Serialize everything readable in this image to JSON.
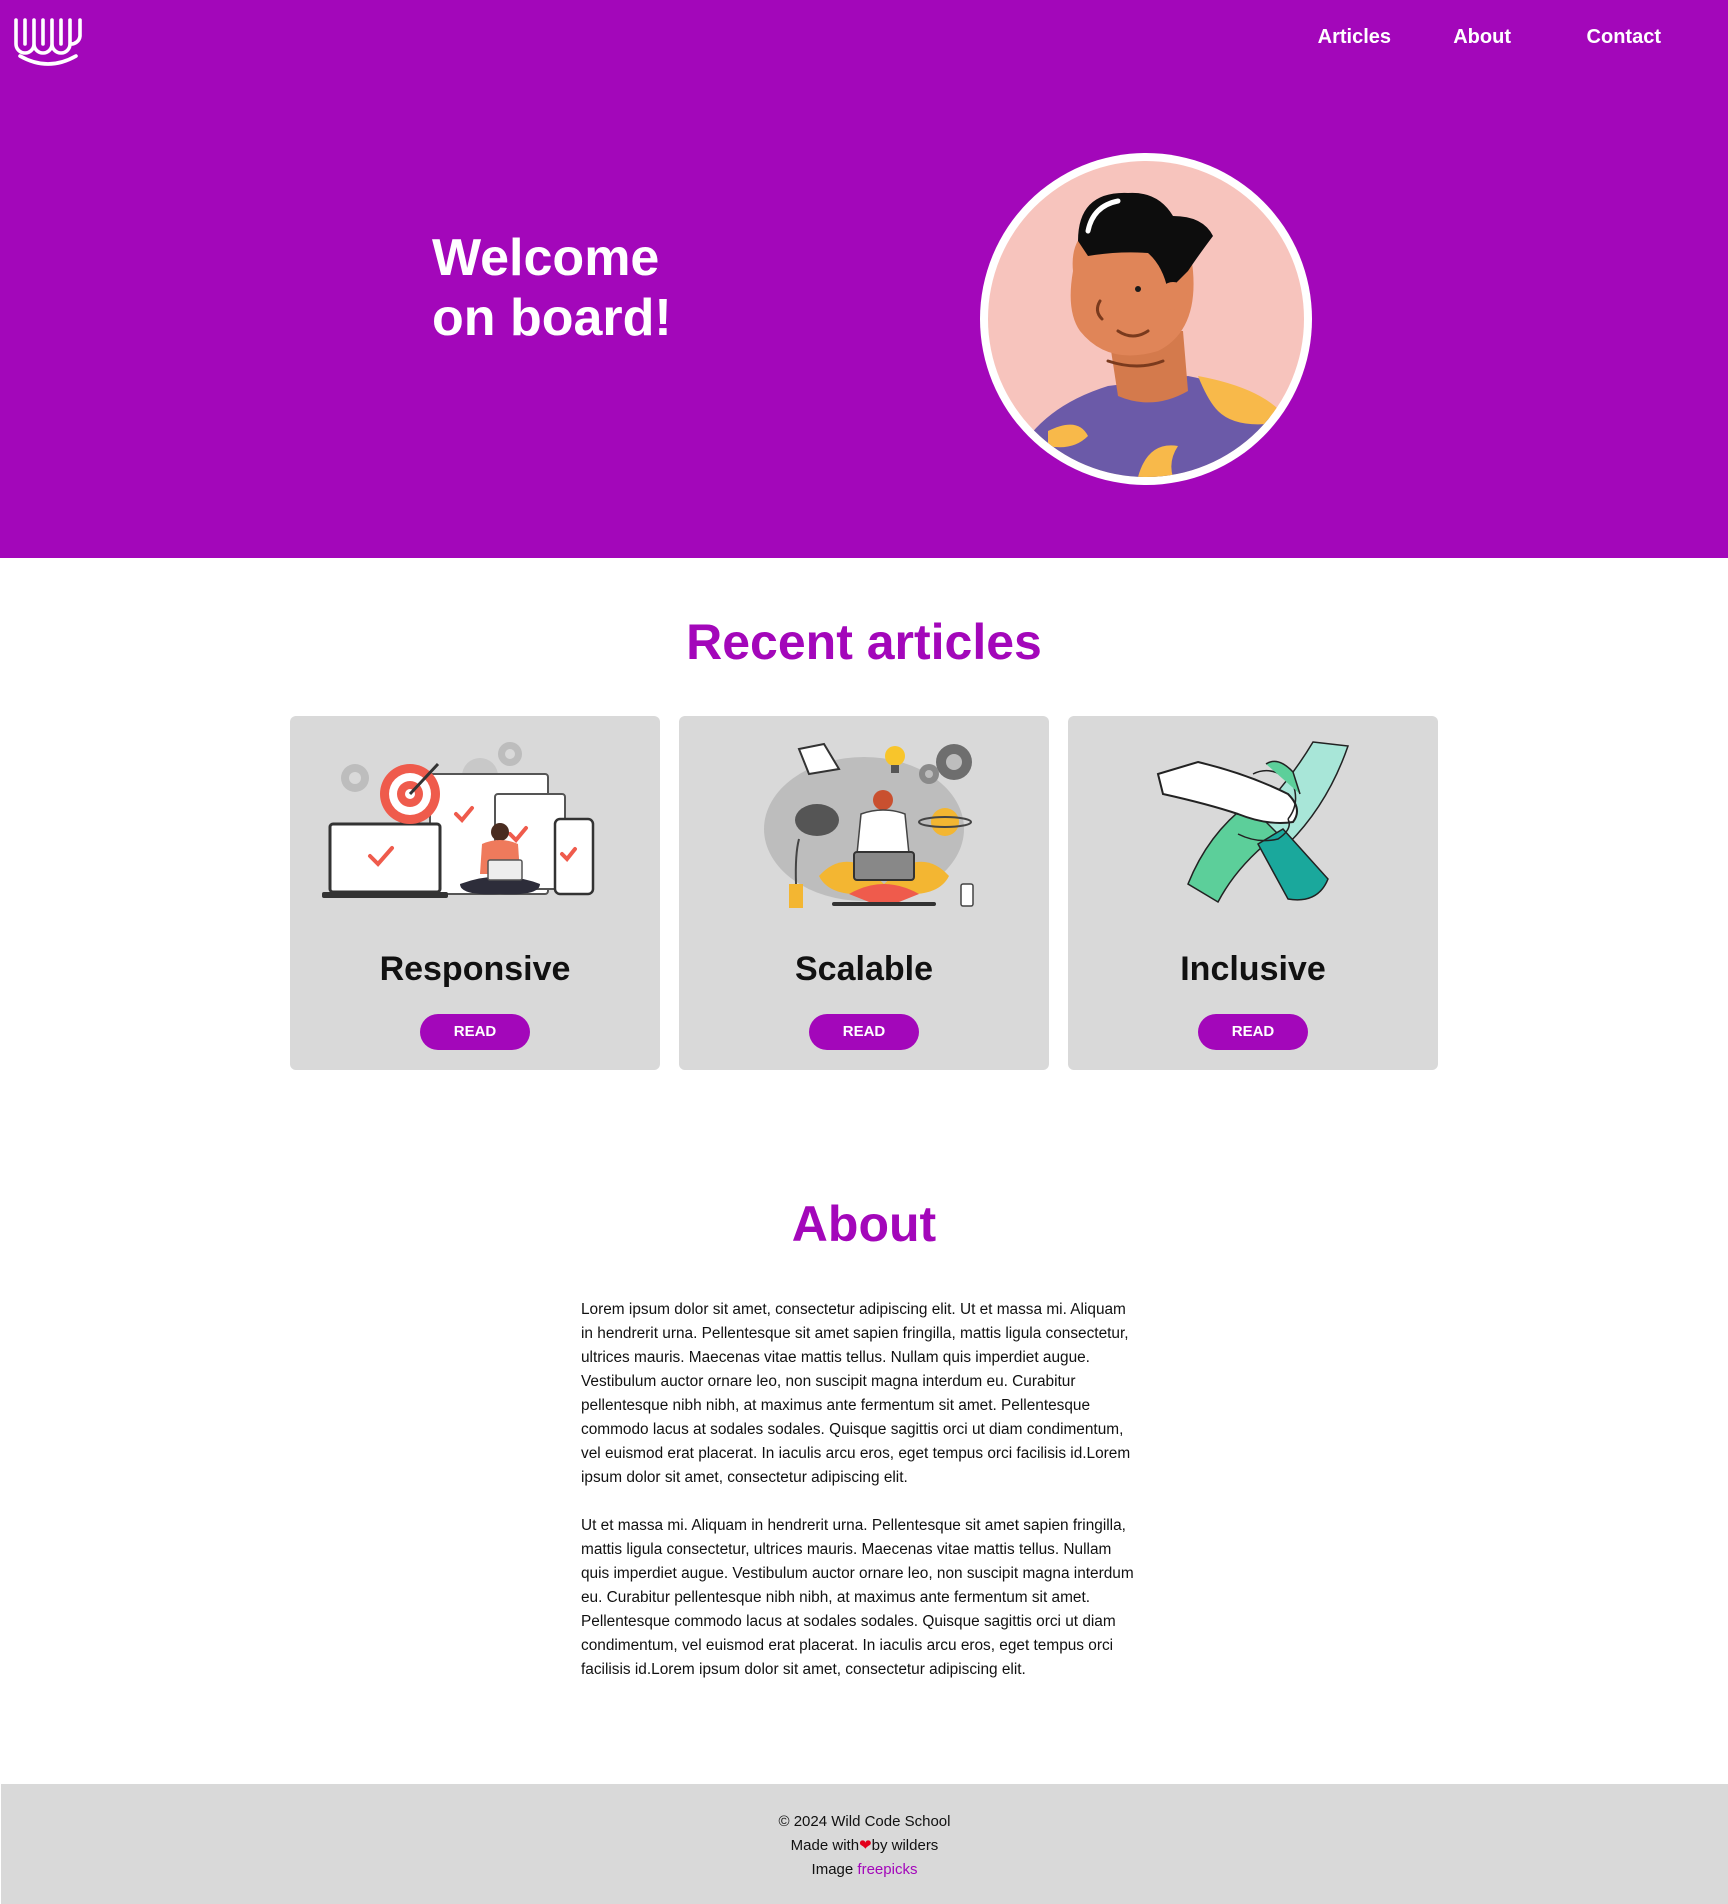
{
  "brand": {
    "primary_color": "#a307ba",
    "logo_icon": "wild-code-school-logo-icon"
  },
  "nav": {
    "items": [
      "Articles",
      "About",
      "Contact"
    ]
  },
  "hero": {
    "title_line1": "Welcome",
    "title_line2": "on board!",
    "avatar_icon": "avatar-illustration"
  },
  "articles": {
    "title": "Recent articles",
    "cards": [
      {
        "title": "Responsive",
        "button": "READ",
        "illustration": "responsive-devices-illustration"
      },
      {
        "title": "Scalable",
        "button": "READ",
        "illustration": "scalable-person-laptop-illustration"
      },
      {
        "title": "Inclusive",
        "button": "READ",
        "illustration": "inclusive-hands-illustration"
      }
    ]
  },
  "about": {
    "title": "About",
    "paragraphs": [
      "Lorem ipsum dolor sit amet, consectetur adipiscing elit. Ut et massa mi. Aliquam in hendrerit urna. Pellentesque sit amet sapien fringilla, mattis ligula consectetur, ultrices mauris. Maecenas vitae mattis tellus. Nullam quis imperdiet augue. Vestibulum auctor ornare leo, non suscipit magna interdum eu. Curabitur pellentesque nibh nibh, at maximus ante fermentum sit amet. Pellentesque commodo lacus at sodales sodales. Quisque sagittis orci ut diam condimentum, vel euismod erat placerat. In iaculis arcu eros, eget tempus orci facilisis id.Lorem ipsum dolor sit amet, consectetur adipiscing elit.",
      "Ut et massa mi. Aliquam in hendrerit urna. Pellentesque sit amet sapien fringilla, mattis ligula consectetur, ultrices mauris. Maecenas vitae mattis tellus. Nullam quis imperdiet augue. Vestibulum auctor ornare leo, non suscipit magna interdum eu. Curabitur pellentesque nibh nibh, at maximus ante fermentum sit amet. Pellentesque commodo lacus at sodales sodales. Quisque sagittis orci ut diam condimentum, vel euismod erat placerat. In iaculis arcu eros, eget tempus orci facilisis id.Lorem ipsum dolor sit amet, consectetur adipiscing elit."
    ]
  },
  "footer": {
    "copyright": "© 2024 Wild Code School",
    "made_with_prefix": "Made with",
    "heart": "❤",
    "made_with_suffix": "by wilders",
    "image_prefix": "Image",
    "image_link": "freepicks",
    "heart_color": "#e3001b"
  }
}
